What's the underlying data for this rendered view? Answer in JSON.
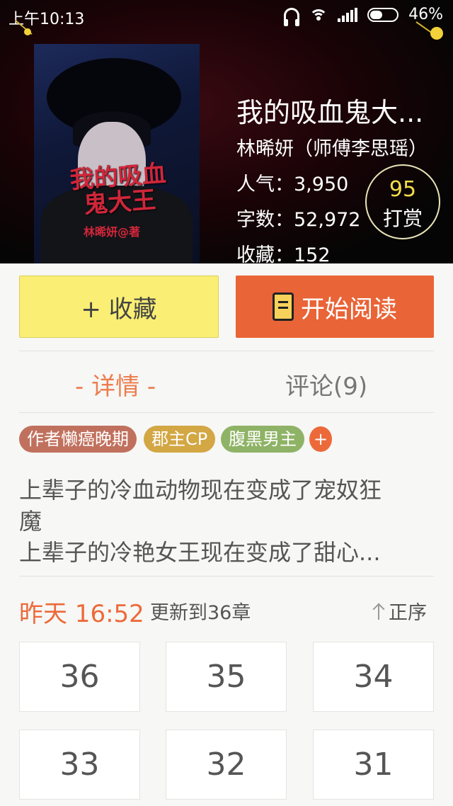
{
  "status_bar": {
    "time": "上午10:13",
    "battery_percent": "46%",
    "battery_level": 0.46,
    "icons": [
      "headphone-icon",
      "wifi-icon",
      "signal-icon",
      "battery-icon"
    ]
  },
  "book": {
    "title": "我的吸血鬼大...",
    "author": "林晞妍（师傅李思瑶）",
    "popularity_label": "人气：",
    "popularity_value": "3,950",
    "word_count_label": "字数：",
    "word_count_value": "52,972",
    "favorites_label": "收藏：",
    "favorites_value": "152",
    "cover_title": "我的吸血鬼大王",
    "cover_author": "林晞妍@著"
  },
  "reward": {
    "count": "95",
    "label": "打赏"
  },
  "actions": {
    "collect_label": "+ 收藏",
    "read_label": "开始阅读"
  },
  "tabs": {
    "detail": "- 详情 -",
    "comments": "评论(9)"
  },
  "tags": [
    "作者懒癌晚期",
    "郡主CP",
    "腹黑男主"
  ],
  "tag_add": "+",
  "description": {
    "line1": "上辈子的冷血动物现在变成了宠奴狂",
    "line2": "魔",
    "line3": "上辈子的冷艳女王现在变成了甜心..."
  },
  "update": {
    "time": "昨天 16:52",
    "text": "更新到36章",
    "sort_label": "正序"
  },
  "chapters": [
    "36",
    "35",
    "34",
    "33",
    "32",
    "31"
  ],
  "colors": {
    "accent_orange": "#e96437",
    "collect_yellow": "#faef74",
    "tag_1": "#c0715d",
    "tag_2": "#d2a744",
    "tag_3": "#8fb366",
    "reward_number": "#f4de4a"
  }
}
